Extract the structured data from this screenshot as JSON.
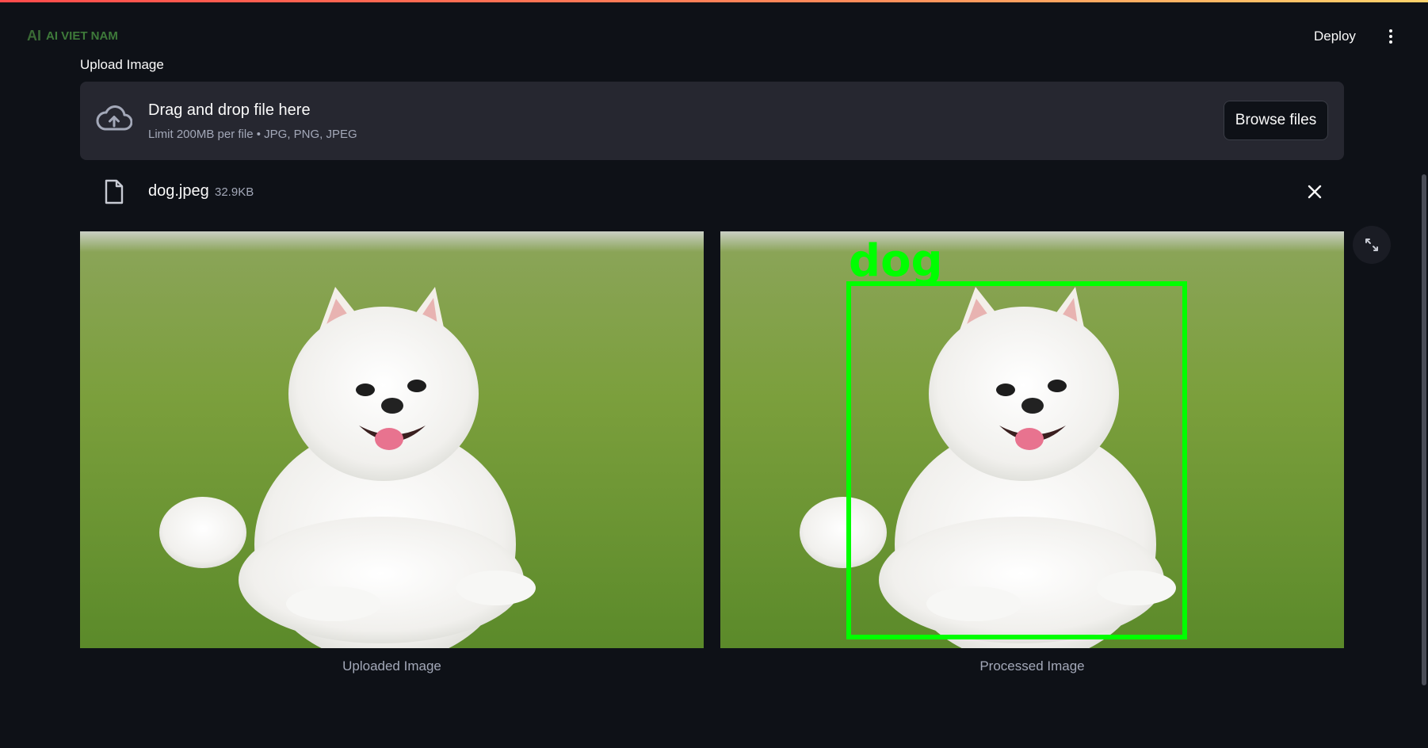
{
  "header": {
    "logo_text": "AI VIET NAM",
    "logo_mark": "AI",
    "deploy_label": "Deploy",
    "menu_icon": "vertical-dots-icon"
  },
  "uploader": {
    "label": "Upload Image",
    "drop_title": "Drag and drop file here",
    "drop_subtitle": "Limit 200MB per file • JPG, PNG, JPEG",
    "browse_label": "Browse files",
    "icon": "cloud-upload-icon"
  },
  "file": {
    "name": "dog.jpeg",
    "size": "32.9KB",
    "icon": "file-icon",
    "remove_icon": "close-icon"
  },
  "images": {
    "uploaded_caption": "Uploaded Image",
    "processed_caption": "Processed Image",
    "detection_label": "dog",
    "detection_color": "#00ff00"
  },
  "colors": {
    "background": "#0e1117",
    "surface": "#262730",
    "muted_text": "#a3a8b8"
  }
}
